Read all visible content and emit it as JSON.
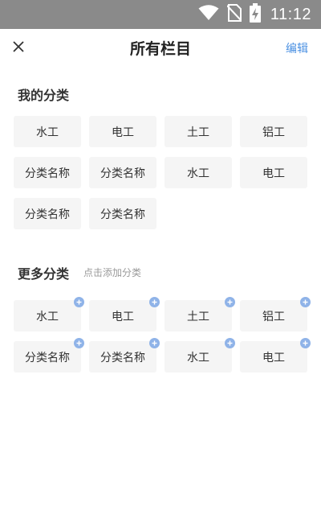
{
  "status_bar": {
    "time": "11:12",
    "icons": [
      "wifi-icon",
      "no-sim-icon",
      "battery-charging-icon"
    ]
  },
  "header": {
    "title": "所有栏目",
    "edit_label": "编辑",
    "close_icon": "close-icon"
  },
  "my_categories": {
    "title": "我的分类",
    "items": [
      "水工",
      "电工",
      "土工",
      "铝工",
      "分类名称",
      "分类名称",
      "水工",
      "电工",
      "分类名称",
      "分类名称"
    ]
  },
  "more_categories": {
    "title": "更多分类",
    "hint": "点击添加分类",
    "items": [
      "水工",
      "电工",
      "土工",
      "铝工",
      "分类名称",
      "分类名称",
      "水工",
      "电工"
    ]
  },
  "colors": {
    "status_bar": "#8a8a8a",
    "accent": "#4a90e2",
    "tile_bg": "#f5f5f5",
    "badge": "#8fb3e8"
  }
}
